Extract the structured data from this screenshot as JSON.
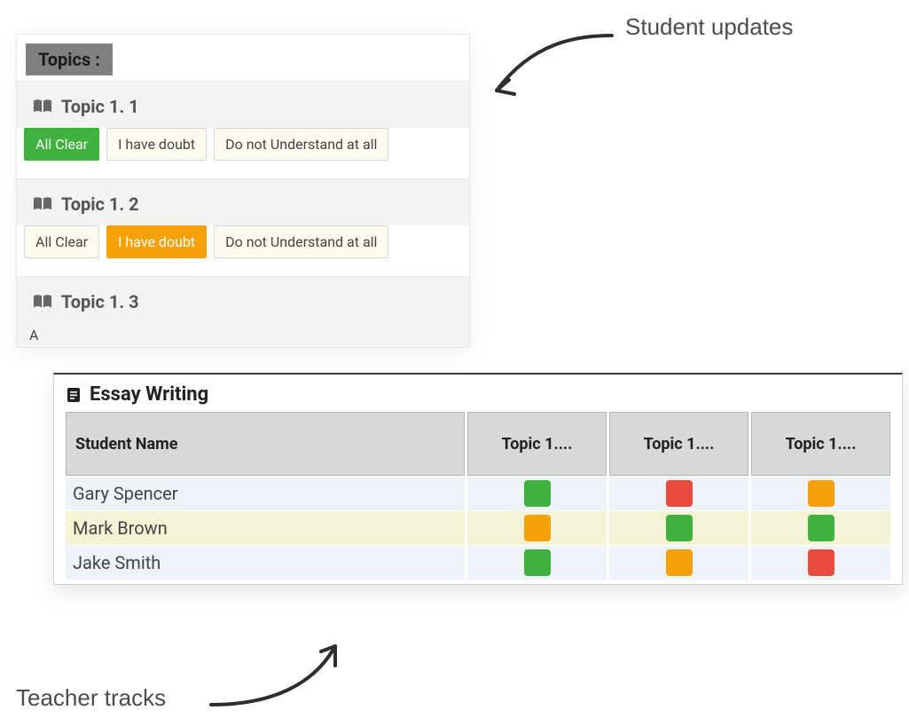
{
  "annotations": {
    "student": "Student updates",
    "teacher": "Teacher tracks"
  },
  "student_panel": {
    "header": "Topics :",
    "topics": [
      {
        "title": "Topic 1. 1",
        "buttons": {
          "clear": "All Clear",
          "doubt": "I have doubt",
          "not": "Do not Understand at all"
        },
        "selected": "clear"
      },
      {
        "title": "Topic 1. 2",
        "buttons": {
          "clear": "All Clear",
          "doubt": "I have doubt",
          "not": "Do not Understand at all"
        },
        "selected": "doubt"
      },
      {
        "title": "Topic 1. 3",
        "partial_visible": "A"
      }
    ]
  },
  "teacher_panel": {
    "title": "Essay Writing",
    "columns": {
      "name": "Student Name",
      "c1": "Topic 1....",
      "c2": "Topic 1....",
      "c3": "Topic 1...."
    },
    "rows": [
      {
        "name": "Gary Spencer",
        "status": [
          "green",
          "red",
          "orange"
        ]
      },
      {
        "name": "Mark Brown",
        "status": [
          "orange",
          "green",
          "green"
        ]
      },
      {
        "name": "Jake Smith",
        "status": [
          "green",
          "orange",
          "red"
        ]
      }
    ]
  },
  "colors": {
    "green": "#3fb13f",
    "orange": "#f5a20a",
    "red": "#e94b3c"
  }
}
